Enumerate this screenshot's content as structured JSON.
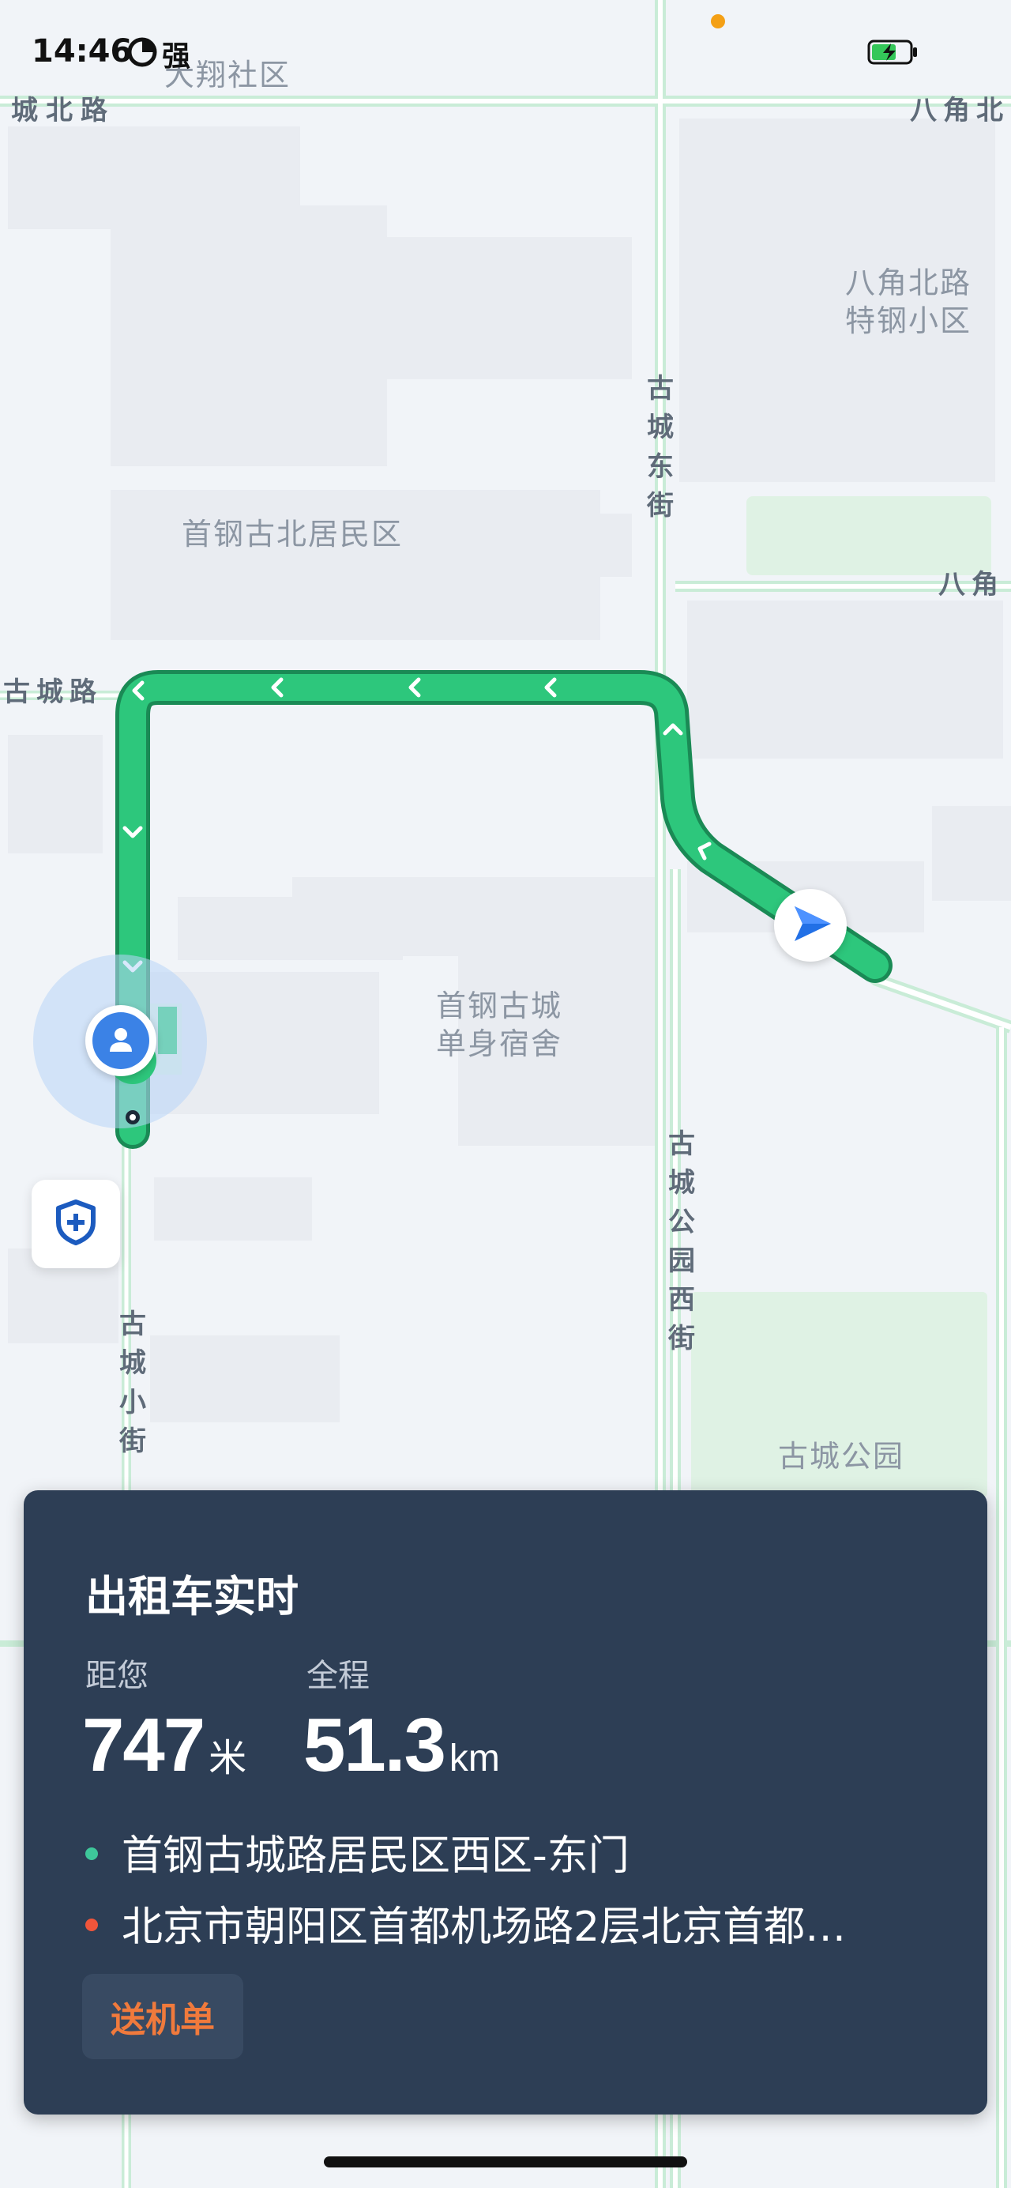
{
  "status_bar": {
    "time": "14:46",
    "carrier": "强",
    "battery_icon": "battery-charging-icon",
    "wifi_icon": "signal-icon"
  },
  "map": {
    "areas": {
      "daxiang": "大翔社区",
      "bajiao_tegang": "八角北路\n特钢小区",
      "shougang_gubei": "首钢古北居民区",
      "shougang_dorm": "首钢古城\n单身宿舍",
      "gucheng_park": "古城公园"
    },
    "roads": {
      "chengbei": "城北路",
      "bajiao_north_top": "八角北",
      "bajiao_north_mid": "八角",
      "gucheng_road": "古城路",
      "gucheng_east": "古城东街",
      "gucheng_park_west": "古城公园西街",
      "gucheng_small": "古城小街"
    }
  },
  "safety_button": {
    "icon": "shield-plus-icon"
  },
  "card": {
    "title": "出租车实时",
    "distance_label": "距您",
    "distance_value": "747",
    "distance_unit": "米",
    "total_label": "全程",
    "total_value": "51.3",
    "total_unit": "km",
    "origin": "首钢古城路居民区西区-东门",
    "destination": "北京市朝阳区首都机场路2层北京首都…",
    "origin_color": "#3ec79a",
    "destination_color": "#f0553b",
    "tag": "送机单"
  },
  "colors": {
    "route": "#2dc77c",
    "route_outline": "#1a8a55",
    "card_bg": "#2d3e55",
    "tag_text": "#f07a3c"
  }
}
